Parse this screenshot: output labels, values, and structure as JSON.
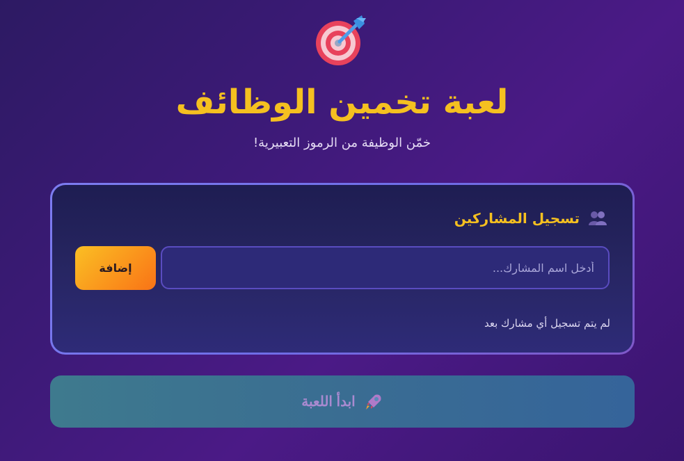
{
  "header": {
    "logo_icon": "dart-target-icon",
    "title": "لعبة تخمين الوظائف",
    "subtitle": "خمّن الوظيفة من الرموز التعبيرية!"
  },
  "registration": {
    "icon": "users-icon",
    "title": "تسجيل المشاركين",
    "input_placeholder": "أدخل اسم المشارك...",
    "input_value": "",
    "add_label": "إضافة",
    "empty_message": "لم يتم تسجيل أي مشارك بعد"
  },
  "start": {
    "icon": "rocket-icon",
    "label": "ابدأ اللعبة"
  },
  "colors": {
    "accent": "#f5c020",
    "add_button_start": "#fbbf24",
    "add_button_end": "#f97316",
    "card_border": "#7d7cf0",
    "start_button": "#3a6d92"
  }
}
